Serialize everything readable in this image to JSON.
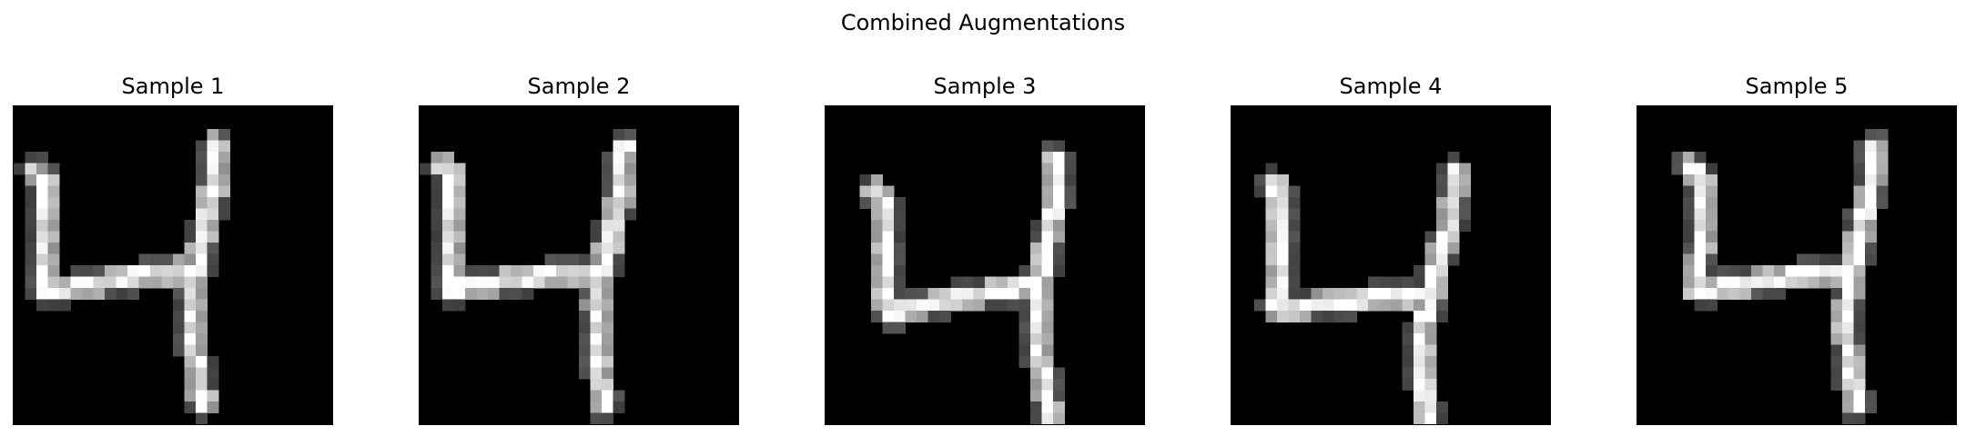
{
  "figure": {
    "title": "Combined Augmentations",
    "colormap": "gray",
    "image_background": "#000000",
    "stroke_color": "#ffffff"
  },
  "samples": [
    {
      "title": "Sample 1",
      "image": "handwritten-digit-4-grayscale"
    },
    {
      "title": "Sample 2",
      "image": "handwritten-digit-4-grayscale"
    },
    {
      "title": "Sample 3",
      "image": "handwritten-digit-4-grayscale"
    },
    {
      "title": "Sample 4",
      "image": "handwritten-digit-4-grayscale"
    },
    {
      "title": "Sample 5",
      "image": "handwritten-digit-4-grayscale"
    }
  ]
}
